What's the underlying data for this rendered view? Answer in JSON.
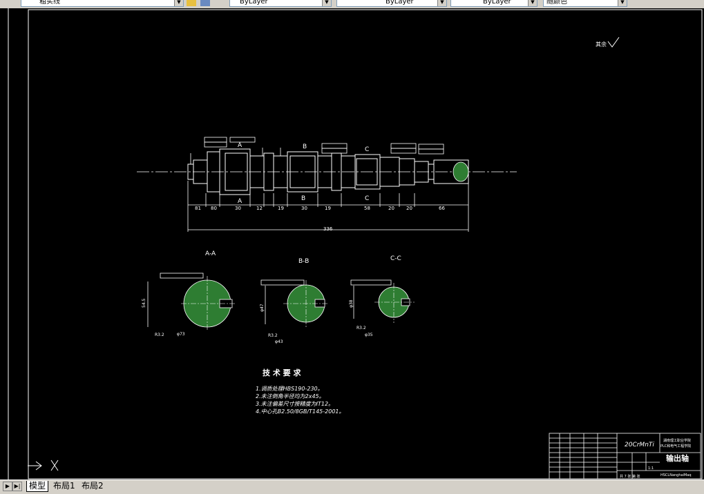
{
  "toolbar": {
    "layer_combo": "粗实线",
    "color_combo": "ByLayer",
    "linetype_combo": "ByLayer",
    "lineweight_combo": "ByLayer",
    "plotstyle_combo": "随颜色"
  },
  "drawing": {
    "roughness_note": "其余",
    "section_labels": [
      "A-A",
      "B-B",
      "C-C"
    ],
    "cut_labels": [
      "A",
      "A",
      "B",
      "B",
      "C",
      "C"
    ],
    "dims_bottom": [
      "81",
      "80",
      "30",
      "12",
      "19",
      "30",
      "19",
      "58",
      "20",
      "20",
      "66"
    ],
    "overall_length": "336",
    "section_dims": {
      "aa_height": "54.5",
      "aa_dia": "φ73",
      "bb_height": "φ47",
      "bb_dia": "φ43",
      "cc_height": "φ38",
      "cc_dia": "φ35",
      "ra": "R3.2"
    },
    "tech_title": "技 术 要 求",
    "tech_items": [
      "1.调质处理HBS190-230。",
      "2.未注倒角半径均为2x45。",
      "3.未注偏差尺寸按精度为IT12。",
      "4.中心孔B2.50/8GB/T145-2001。"
    ],
    "title_block": {
      "material": "20CrMnTi",
      "school": "湖南理工职业学院",
      "school2": "PLC和电气工程学院",
      "part_name": "输出轴",
      "scale": "1:1",
      "sheet": "共 7 张 第 张",
      "drawing_no": "HSCLNanghaiMaq"
    }
  },
  "tabs": {
    "model": "模型",
    "layout1": "布局1",
    "layout2": "布局2"
  }
}
